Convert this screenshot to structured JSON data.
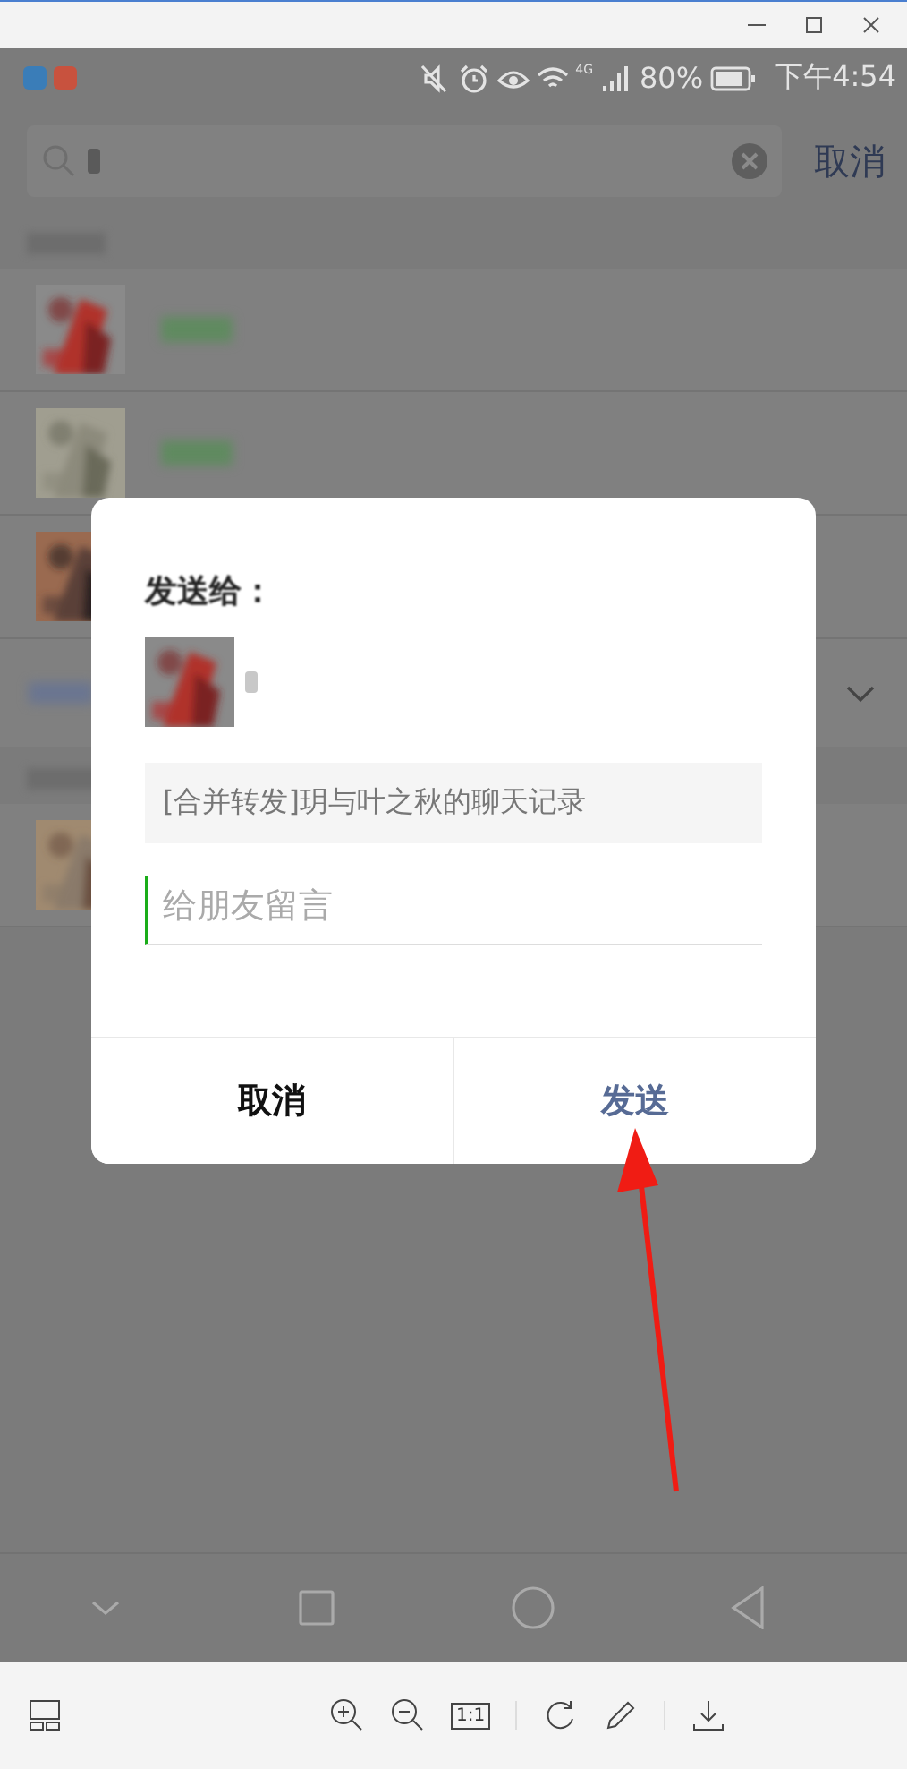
{
  "status_bar": {
    "network": "4G",
    "battery": "80%",
    "time": "下午4:54"
  },
  "search": {
    "cancel": "取消"
  },
  "dialog": {
    "title": "发送给：",
    "message": "[合并转发]玥与叶之秋的聊天记录",
    "note_placeholder": "给朋友留言",
    "buttons": [
      {
        "label": "取消",
        "kind": "cancel"
      },
      {
        "label": "发送",
        "kind": "primary"
      }
    ]
  },
  "toolbar": {
    "actual_size": "1:1"
  }
}
